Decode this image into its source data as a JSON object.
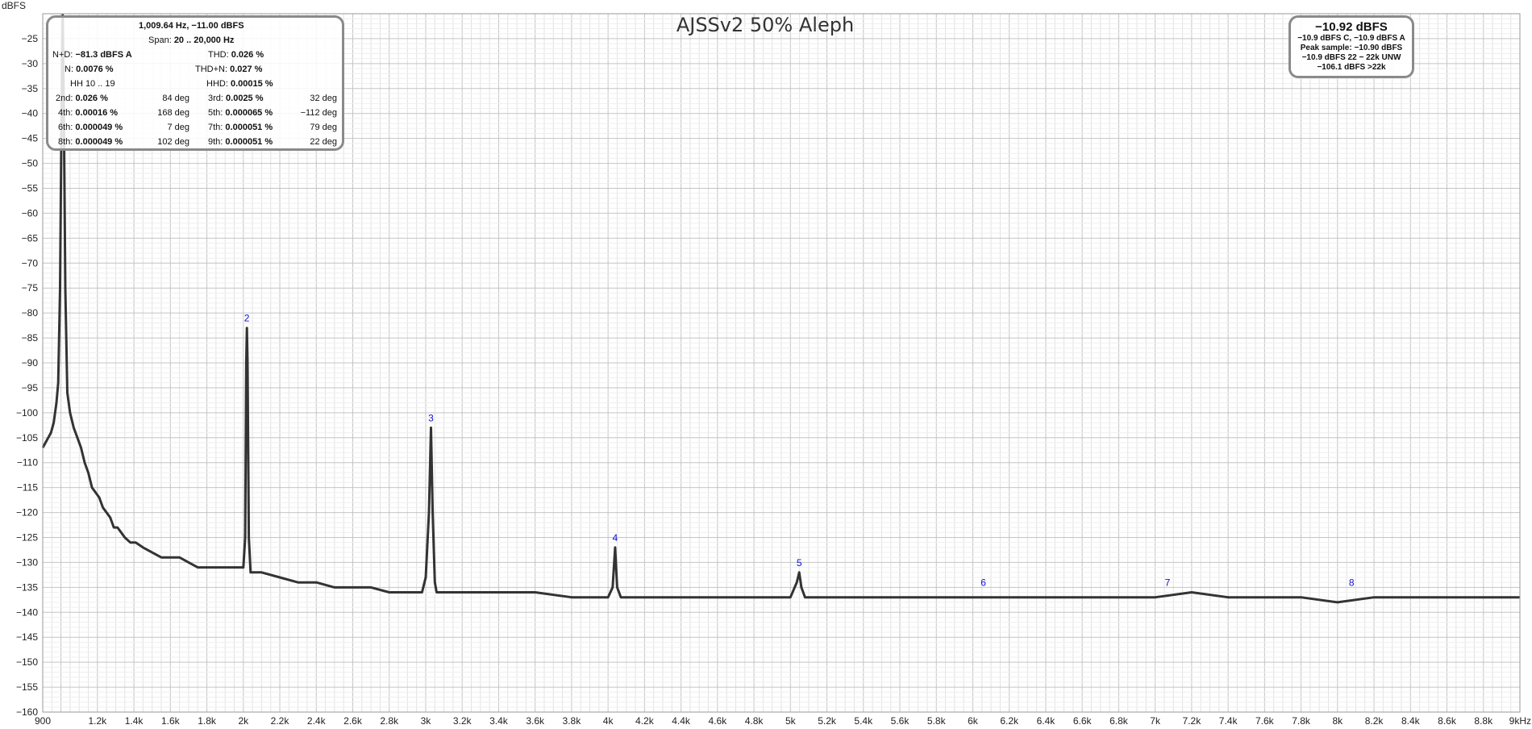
{
  "chart_data": {
    "type": "line",
    "title": "AJSSv2 50% Aleph",
    "ylabel": "dBFS",
    "xlabel": "",
    "xlim": [
      900,
      9000
    ],
    "ylim": [
      -160,
      -20
    ],
    "grid": true,
    "y_ticks": [
      -25,
      -30,
      -35,
      -40,
      -45,
      -50,
      -55,
      -60,
      -65,
      -70,
      -75,
      -80,
      -85,
      -90,
      -95,
      -100,
      -105,
      -110,
      -115,
      -120,
      -125,
      -130,
      -135,
      -140,
      -145,
      -150,
      -155,
      -160
    ],
    "x_ticks": [
      {
        "value": 900,
        "label": "900"
      },
      {
        "value": 1200,
        "label": "1.2k"
      },
      {
        "value": 1400,
        "label": "1.4k"
      },
      {
        "value": 1600,
        "label": "1.6k"
      },
      {
        "value": 1800,
        "label": "1.8k"
      },
      {
        "value": 2000,
        "label": "2k"
      },
      {
        "value": 2200,
        "label": "2.2k"
      },
      {
        "value": 2400,
        "label": "2.4k"
      },
      {
        "value": 2600,
        "label": "2.6k"
      },
      {
        "value": 2800,
        "label": "2.8k"
      },
      {
        "value": 3000,
        "label": "3k"
      },
      {
        "value": 3200,
        "label": "3.2k"
      },
      {
        "value": 3400,
        "label": "3.4k"
      },
      {
        "value": 3600,
        "label": "3.6k"
      },
      {
        "value": 3800,
        "label": "3.8k"
      },
      {
        "value": 4000,
        "label": "4k"
      },
      {
        "value": 4200,
        "label": "4.2k"
      },
      {
        "value": 4400,
        "label": "4.4k"
      },
      {
        "value": 4600,
        "label": "4.6k"
      },
      {
        "value": 4800,
        "label": "4.8k"
      },
      {
        "value": 5000,
        "label": "5k"
      },
      {
        "value": 5200,
        "label": "5.2k"
      },
      {
        "value": 5400,
        "label": "5.4k"
      },
      {
        "value": 5600,
        "label": "5.6k"
      },
      {
        "value": 5800,
        "label": "5.8k"
      },
      {
        "value": 6000,
        "label": "6k"
      },
      {
        "value": 6200,
        "label": "6.2k"
      },
      {
        "value": 6400,
        "label": "6.4k"
      },
      {
        "value": 6600,
        "label": "6.6k"
      },
      {
        "value": 6800,
        "label": "6.8k"
      },
      {
        "value": 7000,
        "label": "7k"
      },
      {
        "value": 7200,
        "label": "7.2k"
      },
      {
        "value": 7400,
        "label": "7.4k"
      },
      {
        "value": 7600,
        "label": "7.6k"
      },
      {
        "value": 7800,
        "label": "7.8k"
      },
      {
        "value": 8000,
        "label": "8k"
      },
      {
        "value": 8200,
        "label": "8.2k"
      },
      {
        "value": 8400,
        "label": "8.4k"
      },
      {
        "value": 8600,
        "label": "8.6k"
      },
      {
        "value": 8800,
        "label": "8.8k"
      },
      {
        "value": 9000,
        "label": "9kHz"
      }
    ],
    "series": [
      {
        "color": "#333333",
        "points": [
          [
            900,
            -107
          ],
          [
            915,
            -106
          ],
          [
            930,
            -105
          ],
          [
            945,
            -104
          ],
          [
            960,
            -102
          ],
          [
            975,
            -98
          ],
          [
            985,
            -94
          ],
          [
            995,
            -75
          ],
          [
            1003,
            -40
          ],
          [
            1009.64,
            -11
          ],
          [
            1016,
            -40
          ],
          [
            1024,
            -75
          ],
          [
            1035,
            -96
          ],
          [
            1050,
            -100
          ],
          [
            1070,
            -103
          ],
          [
            1090,
            -105
          ],
          [
            1110,
            -107
          ],
          [
            1130,
            -110
          ],
          [
            1150,
            -112
          ],
          [
            1170,
            -115
          ],
          [
            1190,
            -116
          ],
          [
            1210,
            -117
          ],
          [
            1230,
            -119
          ],
          [
            1250,
            -120
          ],
          [
            1270,
            -121
          ],
          [
            1290,
            -123
          ],
          [
            1310,
            -123
          ],
          [
            1330,
            -124
          ],
          [
            1350,
            -125
          ],
          [
            1380,
            -126
          ],
          [
            1410,
            -126
          ],
          [
            1450,
            -127
          ],
          [
            1500,
            -128
          ],
          [
            1550,
            -129
          ],
          [
            1600,
            -129
          ],
          [
            1650,
            -129
          ],
          [
            1700,
            -130
          ],
          [
            1750,
            -131
          ],
          [
            1800,
            -131
          ],
          [
            1850,
            -131
          ],
          [
            1900,
            -131
          ],
          [
            1950,
            -131
          ],
          [
            2000,
            -131
          ],
          [
            2010,
            -125
          ],
          [
            2016,
            -90
          ],
          [
            2019.3,
            -83
          ],
          [
            2023,
            -90
          ],
          [
            2030,
            -125
          ],
          [
            2040,
            -132
          ],
          [
            2100,
            -132
          ],
          [
            2200,
            -133
          ],
          [
            2300,
            -134
          ],
          [
            2400,
            -134
          ],
          [
            2500,
            -135
          ],
          [
            2600,
            -135
          ],
          [
            2700,
            -135
          ],
          [
            2800,
            -136
          ],
          [
            2900,
            -136
          ],
          [
            2980,
            -136
          ],
          [
            3000,
            -133
          ],
          [
            3018,
            -120
          ],
          [
            3028.9,
            -103
          ],
          [
            3038,
            -120
          ],
          [
            3050,
            -134
          ],
          [
            3060,
            -136
          ],
          [
            3200,
            -136
          ],
          [
            3400,
            -136
          ],
          [
            3600,
            -136
          ],
          [
            3800,
            -137
          ],
          [
            4000,
            -137
          ],
          [
            4025,
            -135
          ],
          [
            4038.6,
            -127
          ],
          [
            4050,
            -135
          ],
          [
            4070,
            -137
          ],
          [
            4200,
            -137
          ],
          [
            4400,
            -137
          ],
          [
            4600,
            -137
          ],
          [
            4800,
            -137
          ],
          [
            5000,
            -137
          ],
          [
            5035,
            -134
          ],
          [
            5048.2,
            -132
          ],
          [
            5060,
            -135
          ],
          [
            5080,
            -137
          ],
          [
            5300,
            -137
          ],
          [
            5600,
            -137
          ],
          [
            5800,
            -137
          ],
          [
            6000,
            -137
          ],
          [
            6200,
            -137
          ],
          [
            6400,
            -137
          ],
          [
            6600,
            -137
          ],
          [
            6800,
            -137
          ],
          [
            7000,
            -137
          ],
          [
            7200,
            -136
          ],
          [
            7400,
            -137
          ],
          [
            7600,
            -137
          ],
          [
            7800,
            -137
          ],
          [
            8000,
            -138
          ],
          [
            8200,
            -137
          ],
          [
            8400,
            -137
          ],
          [
            8600,
            -137
          ],
          [
            8800,
            -137
          ],
          [
            9000,
            -137
          ]
        ]
      }
    ],
    "markers": [
      {
        "label": "2",
        "x": 2019.3,
        "y": -83
      },
      {
        "label": "3",
        "x": 3028.9,
        "y": -103
      },
      {
        "label": "4",
        "x": 4038.6,
        "y": -127
      },
      {
        "label": "5",
        "x": 5048.2,
        "y": -132
      },
      {
        "label": "6",
        "x": 6057.8,
        "y": -136
      },
      {
        "label": "7",
        "x": 7067.5,
        "y": -136
      },
      {
        "label": "8",
        "x": 8077.1,
        "y": -136
      }
    ]
  },
  "info": {
    "fund": "1,009.64 Hz, −11.00 dBFS",
    "span_label": "Span:",
    "span_value": "20 .. 20,000 Hz",
    "nd_label": "N+D:",
    "nd_value": "−81.3 dBFS A",
    "thd_label": "THD:",
    "thd_value": "0.026 %",
    "n_label": "N:",
    "n_value": "0.0076 %",
    "thdn_label": "THD+N:",
    "thdn_value": "0.027 %",
    "hh_label": "HH 10 .. 19",
    "hhd_label": "HHD:",
    "hhd_value": "0.00015 %",
    "h2_label": "2nd:",
    "h2_value": "0.026 %",
    "h2_phase": "84 deg",
    "h3_label": "3rd:",
    "h3_value": "0.0025 %",
    "h3_phase": "32 deg",
    "h4_label": "4th:",
    "h4_value": "0.00016 %",
    "h4_phase": "168 deg",
    "h5_label": "5th:",
    "h5_value": "0.000065 %",
    "h5_phase": "−112 deg",
    "h6_label": "6th:",
    "h6_value": "0.000049 %",
    "h6_phase": "7 deg",
    "h7_label": "7th:",
    "h7_value": "0.000051 %",
    "h7_phase": "79 deg",
    "h8_label": "8th:",
    "h8_value": "0.000049 %",
    "h8_phase": "102 deg",
    "h9_label": "9th:",
    "h9_value": "0.000051 %",
    "h9_phase": "22 deg"
  },
  "level": {
    "main": "−10.92 dBFS",
    "line1": "−10.9 dBFS C, −10.9 dBFS A",
    "line2": "Peak sample: −10.90 dBFS",
    "line3": "−10.9 dBFS 22 − 22k UNW",
    "line4": "−106.1 dBFS >22k"
  }
}
